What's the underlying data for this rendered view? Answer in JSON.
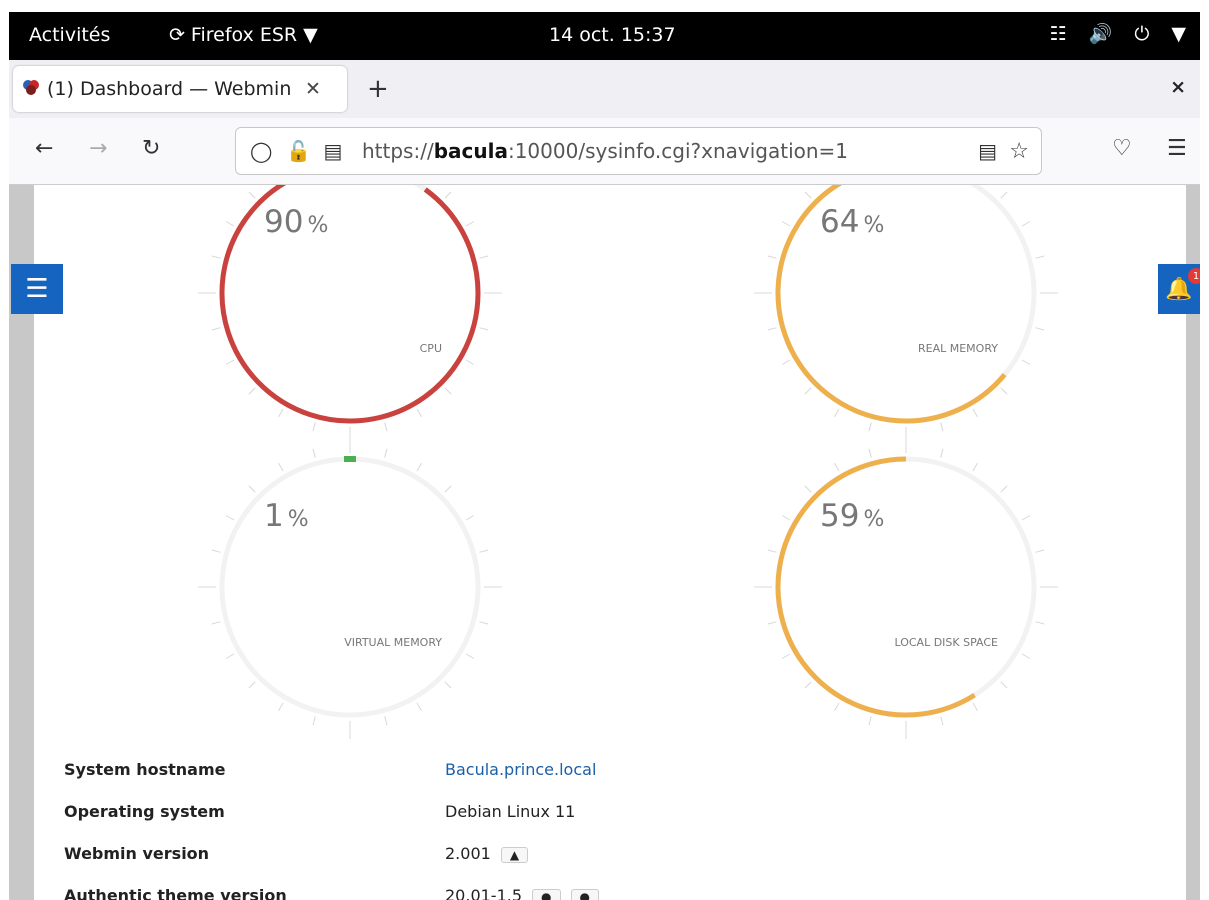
{
  "topbar": {
    "activities": "Activités",
    "app_name": "Firefox ESR",
    "clock": "14 oct.  15:37"
  },
  "tabs": {
    "active_title": "(1) Dashboard — Webmin",
    "new_tab_symbol": "+",
    "close_window_symbol": "×"
  },
  "navbar": {
    "url_prefix": "https://",
    "url_host": "bacula",
    "url_rest": ":10000/sysinfo.cgi?xnavigation=1"
  },
  "notifications": {
    "count": "1"
  },
  "gauges": [
    {
      "label": "CPU",
      "percent": 90,
      "percent_text": "90",
      "color": "#c9423e"
    },
    {
      "label": "REAL MEMORY",
      "percent": 64,
      "percent_text": "64",
      "color": "#eeb04c"
    },
    {
      "label": "VIRTUAL MEMORY",
      "percent": 1,
      "percent_text": "1",
      "color": "#4caf50"
    },
    {
      "label": "LOCAL DISK SPACE",
      "percent": 59,
      "percent_text": "59",
      "color": "#eeb04c"
    }
  ],
  "percent_unit": "%",
  "sysinfo": {
    "hostname_label": "System hostname",
    "hostname_value": "Bacula.prince.local",
    "os_label": "Operating system",
    "os_value": "Debian Linux 11",
    "webmin_label": "Webmin version",
    "webmin_value": "2.001",
    "theme_label": "Authentic theme version",
    "theme_value": "20.01-1.5"
  }
}
